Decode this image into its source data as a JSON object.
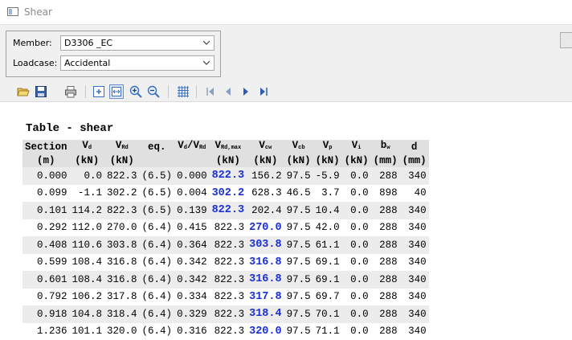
{
  "window": {
    "title": "Shear"
  },
  "selectors": {
    "member_label": "Member:",
    "member_value": "D3306 _EC",
    "loadcase_label": "Loadcase:",
    "loadcase_value": "Accidental"
  },
  "toolbar": {
    "icons": [
      "open-folder-icon",
      "save-icon",
      "print-icon",
      "zoom-fit-icon",
      "zoom-width-icon",
      "zoom-in-icon",
      "zoom-out-icon",
      "grid-icon",
      "first-page-icon",
      "previous-page-icon",
      "next-page-icon",
      "last-page-icon"
    ]
  },
  "table": {
    "title": "Table - shear",
    "headers": [
      {
        "main": "Section",
        "sub": "",
        "unit": "(m)"
      },
      {
        "main": "V",
        "sub": "d",
        "unit": "(kN)"
      },
      {
        "main": "V",
        "sub": "Rd",
        "unit": "(kN)"
      },
      {
        "main": "eq.",
        "sub": "",
        "unit": ""
      },
      {
        "main": "V",
        "sub": "d",
        "main2": "/V",
        "sub2": "Rd",
        "unit": ""
      },
      {
        "main": "V",
        "sub": "Rd,max",
        "unit": "(kN)"
      },
      {
        "main": "V",
        "sub": "cw",
        "unit": "(kN)"
      },
      {
        "main": "V",
        "sub": "cb",
        "unit": "(kN)"
      },
      {
        "main": "V",
        "sub": "p",
        "unit": "(kN)"
      },
      {
        "main": "V",
        "sub": "i",
        "unit": "(kN)"
      },
      {
        "main": "b",
        "sub": "w",
        "unit": "(mm)"
      },
      {
        "main": "d",
        "sub": "",
        "unit": "(mm)"
      }
    ],
    "rows": [
      {
        "section": "0.000",
        "vd": "0.0",
        "vrd": "822.3",
        "eq": "(6.5)",
        "ratio": "0.000",
        "vrdmax": "822.3",
        "vcw": "156.2",
        "vcb": "97.5",
        "vp": "-5.9",
        "vi": "0.0",
        "bw": "288",
        "d": "340",
        "bold_col": "vrdmax"
      },
      {
        "section": "0.099",
        "vd": "-1.1",
        "vrd": "302.2",
        "eq": "(6.5)",
        "ratio": "0.004",
        "vrdmax": "302.2",
        "vcw": "628.3",
        "vcb": "46.5",
        "vp": "3.7",
        "vi": "0.0",
        "bw": "898",
        "d": "40",
        "bold_col": "vrdmax"
      },
      {
        "section": "0.101",
        "vd": "114.2",
        "vrd": "822.3",
        "eq": "(6.5)",
        "ratio": "0.139",
        "vrdmax": "822.3",
        "vcw": "202.4",
        "vcb": "97.5",
        "vp": "10.4",
        "vi": "0.0",
        "bw": "288",
        "d": "340",
        "bold_col": "vrdmax"
      },
      {
        "section": "0.292",
        "vd": "112.0",
        "vrd": "270.0",
        "eq": "(6.4)",
        "ratio": "0.415",
        "vrdmax": "822.3",
        "vcw": "270.0",
        "vcb": "97.5",
        "vp": "42.0",
        "vi": "0.0",
        "bw": "288",
        "d": "340",
        "bold_col": "vcw"
      },
      {
        "section": "0.408",
        "vd": "110.6",
        "vrd": "303.8",
        "eq": "(6.4)",
        "ratio": "0.364",
        "vrdmax": "822.3",
        "vcw": "303.8",
        "vcb": "97.5",
        "vp": "61.1",
        "vi": "0.0",
        "bw": "288",
        "d": "340",
        "bold_col": "vcw"
      },
      {
        "section": "0.599",
        "vd": "108.4",
        "vrd": "316.8",
        "eq": "(6.4)",
        "ratio": "0.342",
        "vrdmax": "822.3",
        "vcw": "316.8",
        "vcb": "97.5",
        "vp": "69.1",
        "vi": "0.0",
        "bw": "288",
        "d": "340",
        "bold_col": "vcw"
      },
      {
        "section": "0.601",
        "vd": "108.4",
        "vrd": "316.8",
        "eq": "(6.4)",
        "ratio": "0.342",
        "vrdmax": "822.3",
        "vcw": "316.8",
        "vcb": "97.5",
        "vp": "69.1",
        "vi": "0.0",
        "bw": "288",
        "d": "340",
        "bold_col": "vcw"
      },
      {
        "section": "0.792",
        "vd": "106.2",
        "vrd": "317.8",
        "eq": "(6.4)",
        "ratio": "0.334",
        "vrdmax": "822.3",
        "vcw": "317.8",
        "vcb": "97.5",
        "vp": "69.7",
        "vi": "0.0",
        "bw": "288",
        "d": "340",
        "bold_col": "vcw"
      },
      {
        "section": "0.918",
        "vd": "104.8",
        "vrd": "318.4",
        "eq": "(6.4)",
        "ratio": "0.329",
        "vrdmax": "822.3",
        "vcw": "318.4",
        "vcb": "97.5",
        "vp": "70.1",
        "vi": "0.0",
        "bw": "288",
        "d": "340",
        "bold_col": "vcw"
      },
      {
        "section": "1.236",
        "vd": "101.1",
        "vrd": "320.0",
        "eq": "(6.4)",
        "ratio": "0.316",
        "vrdmax": "822.3",
        "vcw": "320.0",
        "vcb": "97.5",
        "vp": "71.1",
        "vi": "0.0",
        "bw": "288",
        "d": "340",
        "bold_col": "vcw"
      }
    ]
  },
  "colors": {
    "highlight_value": "#1a2fd4",
    "row_alt": "#ececec",
    "header_bg": "#e0e0e0"
  }
}
